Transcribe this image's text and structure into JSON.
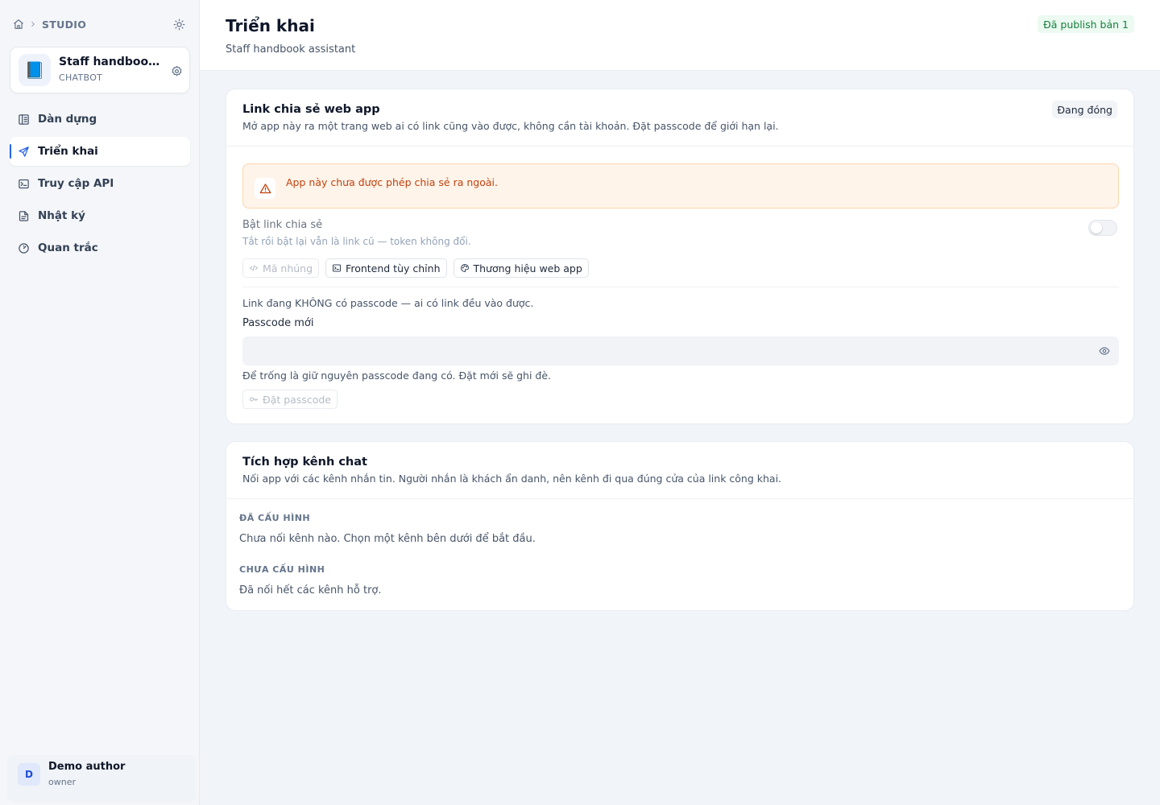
{
  "sidebar": {
    "breadcrumb": "STUDIO",
    "app": {
      "icon": "📘",
      "name": "Staff handbook assistant",
      "kind": "CHATBOT"
    },
    "nav": [
      {
        "label": "Dàn dựng",
        "icon": "layout-icon",
        "active": false
      },
      {
        "label": "Triển khai",
        "icon": "send-icon",
        "active": true
      },
      {
        "label": "Truy cập API",
        "icon": "terminal-icon",
        "active": false
      },
      {
        "label": "Nhật ký",
        "icon": "file-text-icon",
        "active": false
      },
      {
        "label": "Quan trắc",
        "icon": "gauge-icon",
        "active": false
      }
    ],
    "user": {
      "initial": "D",
      "name": "Demo author",
      "role": "owner"
    }
  },
  "header": {
    "title": "Triển khai",
    "subtitle": "Staff handbook assistant",
    "badge": "Đã publish bản 1"
  },
  "share": {
    "title": "Link chia sẻ web app",
    "desc": "Mở app này ra một trang web ai có link cũng vào được, không cần tài khoản. Đặt passcode để giới hạn lại.",
    "status": "Đang đóng",
    "warning": "App này chưa được phép chia sẻ ra ngoài.",
    "toggle_label": "Bật link chia sẻ",
    "toggle_help": "Tắt rồi bật lại vẫn là link cũ — token không đổi.",
    "toggle_on": false,
    "buttons": {
      "embed": "Mã nhúng",
      "frontend": "Frontend tùy chỉnh",
      "branding": "Thương hiệu web app"
    },
    "passcode_status": "Link đang KHÔNG có passcode — ai có link đều vào được.",
    "passcode_label": "Passcode mới",
    "passcode_value": "",
    "passcode_help": "Để trống là giữ nguyên passcode đang có. Đặt mới sẽ ghi đè.",
    "set_passcode": "Đặt passcode"
  },
  "channels": {
    "title": "Tích hợp kênh chat",
    "desc": "Nối app với các kênh nhắn tin. Người nhắn là khách ẩn danh, nên kênh đi qua đúng cửa của link công khai.",
    "configured_label": "ĐÃ CẤU HÌNH",
    "configured_text": "Chưa nối kênh nào. Chọn một kênh bên dưới để bắt đầu.",
    "unconfigured_label": "CHƯA CẤU HÌNH",
    "unconfigured_text": "Đã nối hết các kênh hỗ trợ."
  },
  "colors": {
    "accent": "#2563eb",
    "warning_text": "#c2410c",
    "warning_bg": "#fff4ea",
    "success_text": "#15803d",
    "success_bg": "#ecfaf1"
  }
}
